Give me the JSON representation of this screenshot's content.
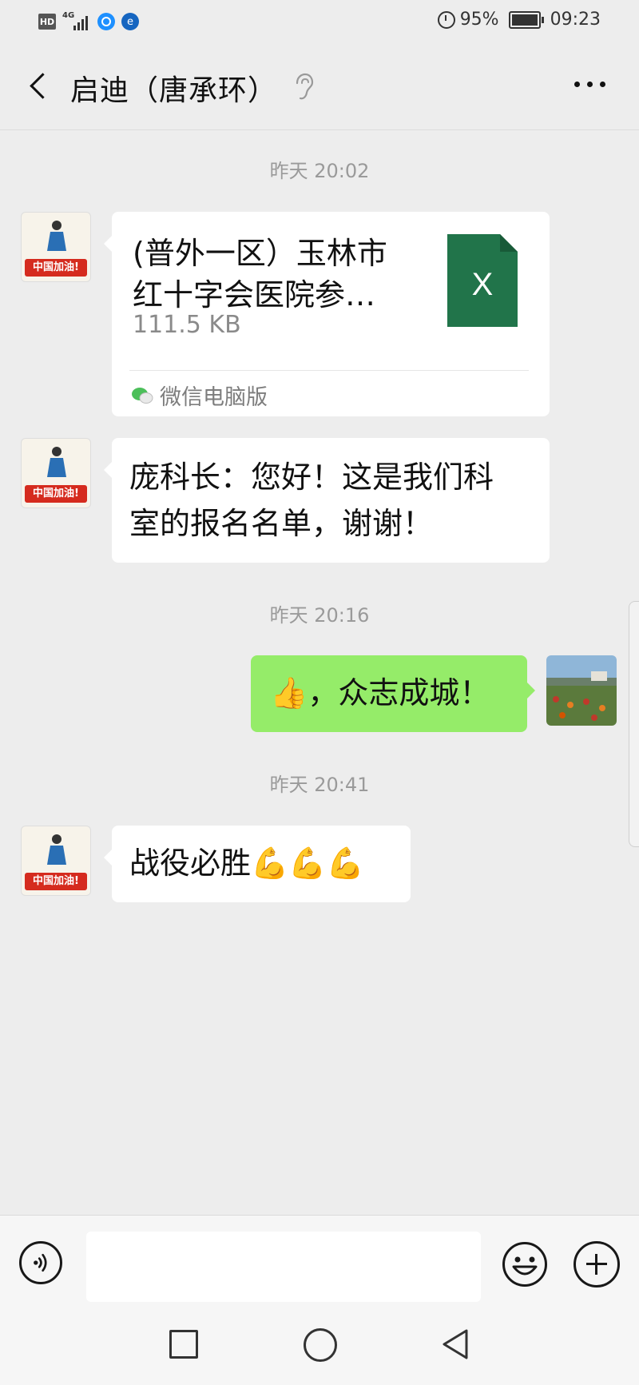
{
  "status_bar": {
    "hd": "HD",
    "network": "4G",
    "battery": "95%",
    "time": "09:23"
  },
  "header": {
    "title": "启迪（唐承环）",
    "icons": [
      "back-arrow-icon",
      "ear-icon",
      "more-icon"
    ]
  },
  "messages": [
    {
      "type": "timestamp",
      "text": "昨天 20:02"
    },
    {
      "type": "file",
      "from": "other",
      "title_line1": "(普外一区）玉林市",
      "title_line2": "红十字会医院参…",
      "size": "111.5 KB",
      "icon": "excel-file-icon",
      "icon_letter": "X",
      "source": "微信电脑版"
    },
    {
      "type": "text",
      "from": "other",
      "line1": "庞科长：您好！这是我们科",
      "line2": "室的报名名单，谢谢！"
    },
    {
      "type": "timestamp",
      "text": "昨天 20:16"
    },
    {
      "type": "text",
      "from": "me",
      "emoji": "👍",
      "text": "，众志成城！"
    },
    {
      "type": "timestamp",
      "text": "昨天 20:41"
    },
    {
      "type": "text",
      "from": "other",
      "text": "战役必胜",
      "emoji": "💪💪💪"
    }
  ],
  "avatar": {
    "banner": "中国加油!"
  },
  "input_bar": {
    "placeholder": "",
    "icons": [
      "voice-icon",
      "emoji-icon",
      "plus-icon"
    ]
  },
  "system_nav": {
    "icons": [
      "recent-apps-icon",
      "home-icon",
      "back-icon"
    ]
  },
  "colors": {
    "background": "#ededed",
    "my_bubble": "#95ec69",
    "other_bubble": "#ffffff",
    "excel": "#21744a",
    "avatar_banner": "#d52b1e"
  }
}
